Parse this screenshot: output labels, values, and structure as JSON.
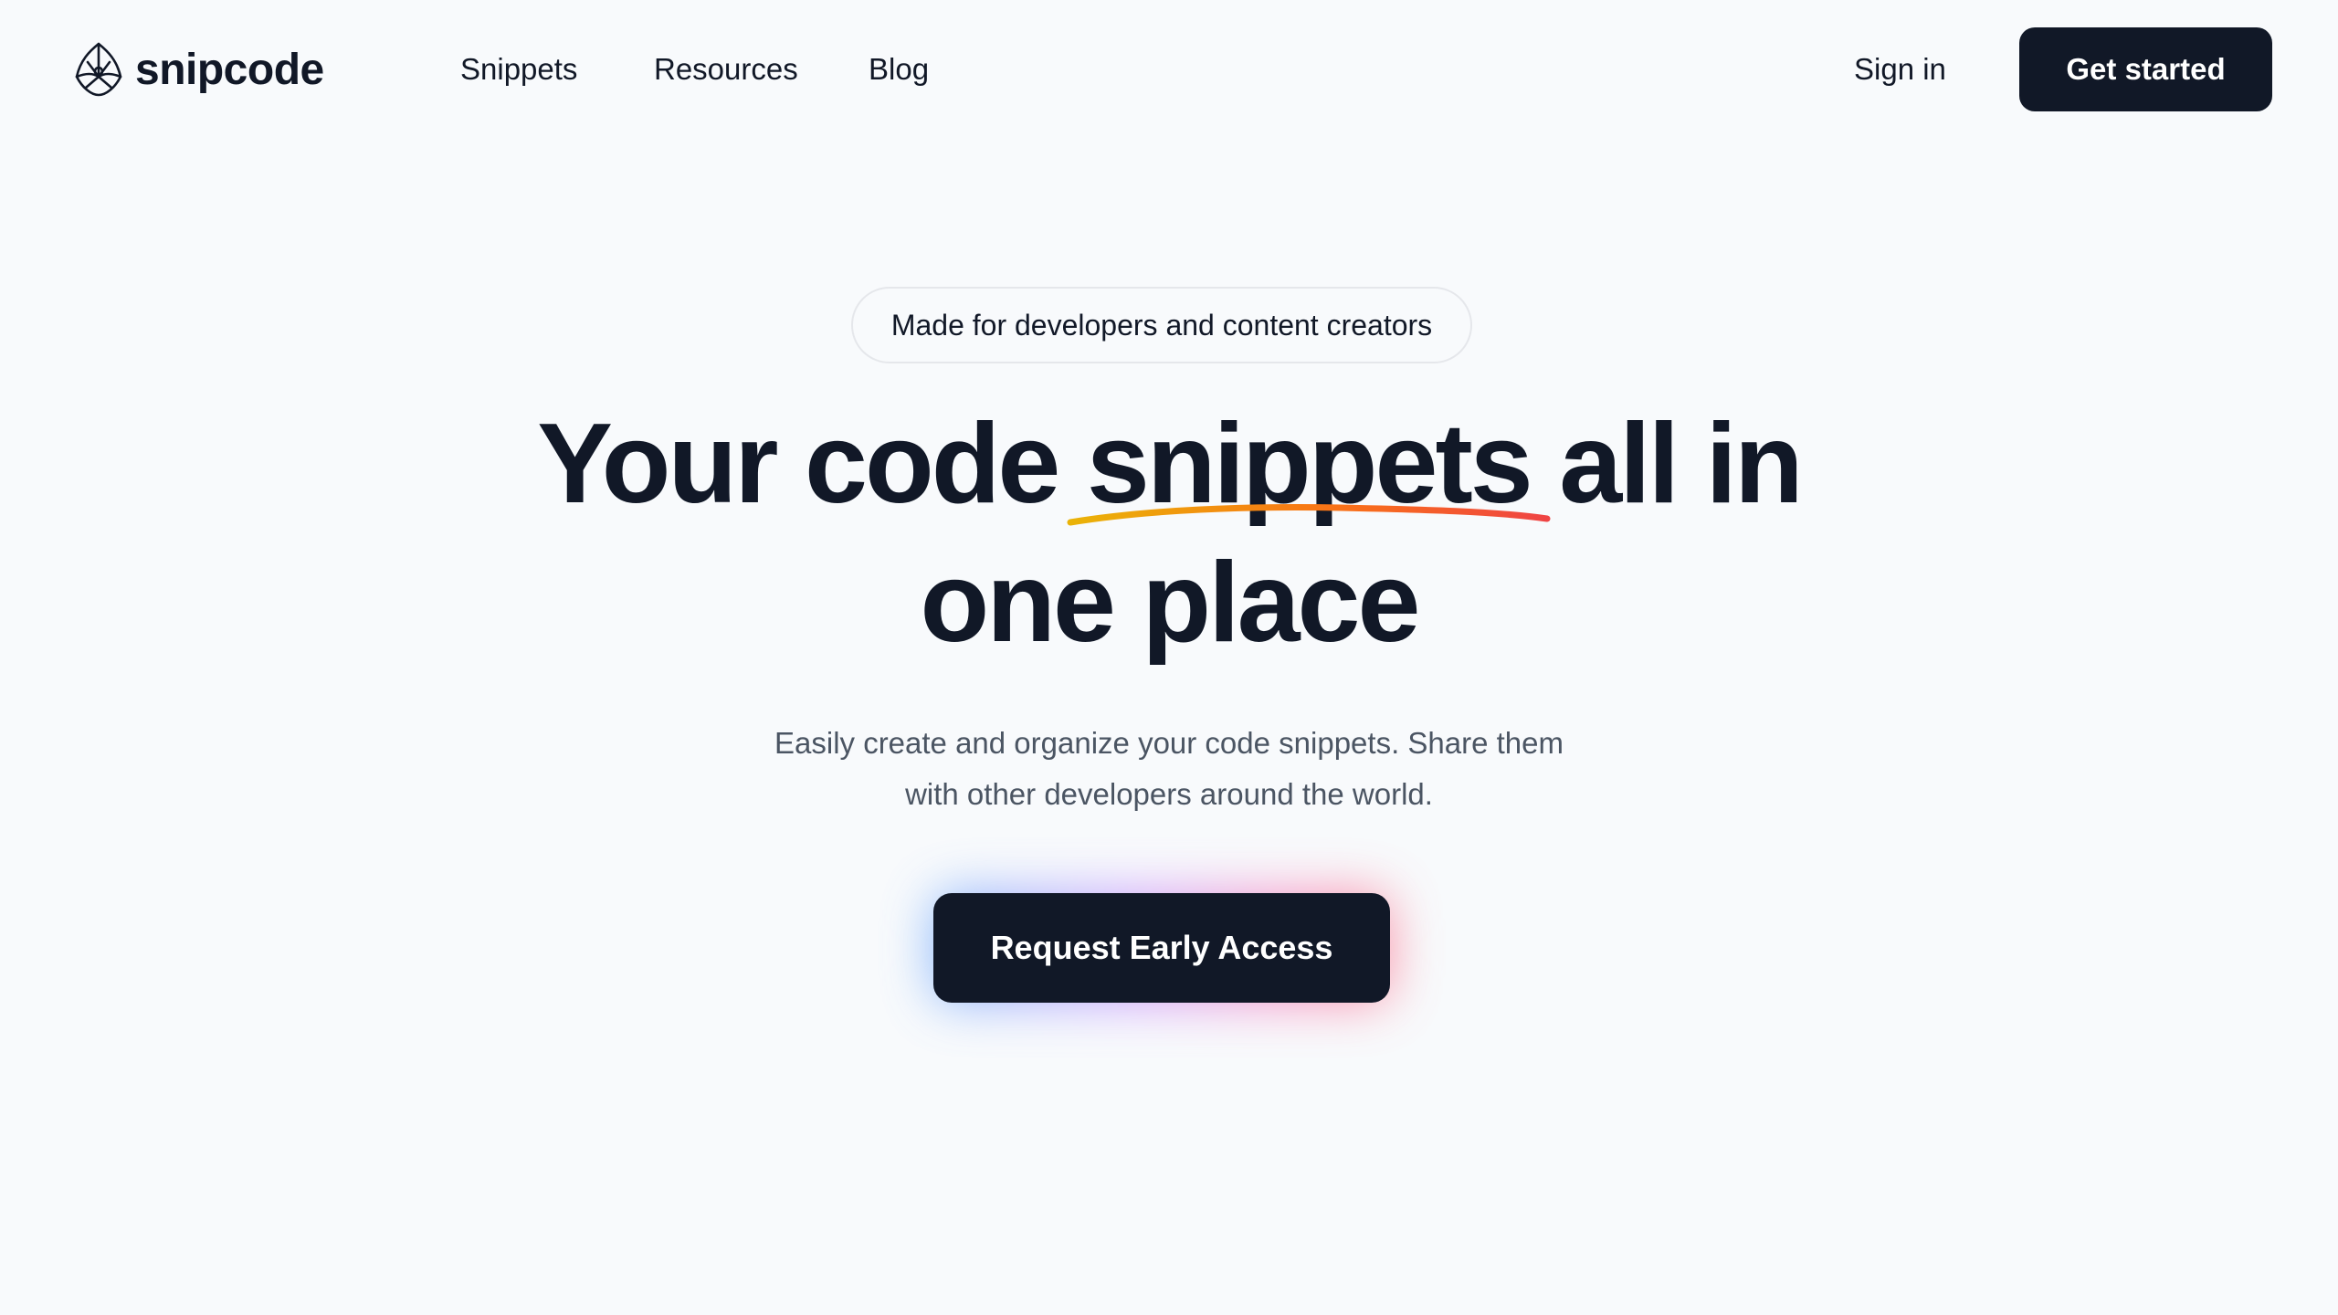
{
  "brand": {
    "name": "snipcode",
    "logo_icon": "snipcode-logo-icon"
  },
  "nav": {
    "links": [
      {
        "label": "Snippets"
      },
      {
        "label": "Resources"
      },
      {
        "label": "Blog"
      }
    ],
    "sign_in": "Sign in",
    "get_started": "Get started"
  },
  "hero": {
    "badge": "Made for developers and content creators",
    "headline_before": "Your code",
    "headline_highlight": "snippets",
    "headline_after": "all in",
    "headline_line2": "one place",
    "subtitle_line1": "Easily create and organize your code snippets. Share them",
    "subtitle_line2": "with other developers around the world.",
    "cta": "Request Early Access"
  },
  "colors": {
    "background": "#f8fafc",
    "primary": "#111827",
    "muted_text": "#4b5563",
    "squiggle_start": "#eab308",
    "squiggle_end": "#ef4444"
  }
}
